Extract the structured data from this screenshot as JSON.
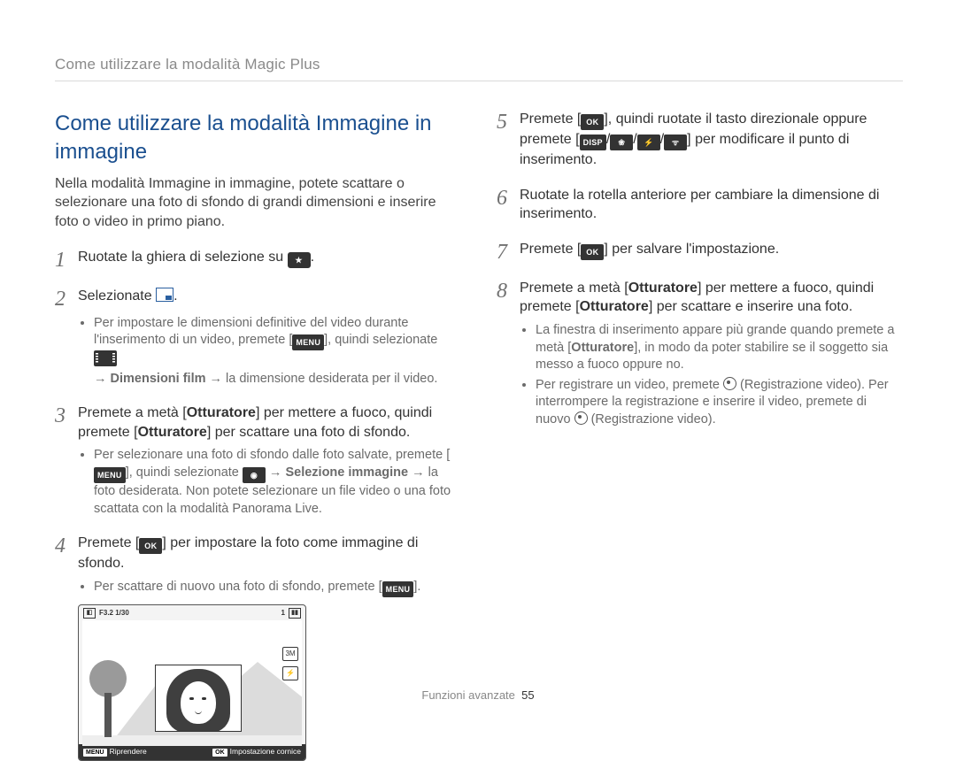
{
  "running_head": "Come utilizzare la modalità Magic Plus",
  "title": "Come utilizzare la modalità Immagine in immagine",
  "intro": "Nella modalità Immagine in immagine, potete scattare o selezionare una foto di sfondo di grandi dimensioni e inserire foto o video in primo piano.",
  "left_steps": {
    "s1": "Ruotate la ghiera di selezione su ",
    "s1_end": ".",
    "s2": "Selezionate ",
    "s2_end": ".",
    "s2_note_a": "Per impostare le dimensioni definitive del video durante l'inserimento di un video, premete [",
    "s2_note_a2": "], quindi selezionate ",
    "s2_note_a3": " → ",
    "s2_note_a_bold": "Dimensioni film",
    "s2_note_a4": " → la dimensione desiderata per il video.",
    "s3_a": "Premete a metà [",
    "s3_bold1": "Otturatore",
    "s3_b": "] per mettere a fuoco, quindi premete [",
    "s3_bold2": "Otturatore",
    "s3_c": "] per scattare una foto di sfondo.",
    "s3_note_a": "Per selezionare una foto di sfondo dalle foto salvate, premete [",
    "s3_note_b": "], quindi selezionate ",
    "s3_note_arrow": " → ",
    "s3_note_bold": "Selezione immagine",
    "s3_note_c": " → la foto desiderata. Non potete selezionare un file video o una foto scattata con la modalità Panorama Live.",
    "s4_a": "Premete [",
    "s4_b": "] per impostare la foto come immagine di sfondo.",
    "s4_note": "Per scattare di nuovo una foto di sfondo, premete [",
    "s4_note_end": "]."
  },
  "right_steps": {
    "s5_a": "Premete [",
    "s5_b": "], quindi ruotate il tasto direzionale oppure premete [",
    "s5_c": "] per modificare il punto di inserimento.",
    "s6": "Ruotate la rotella anteriore per cambiare la dimensione di inserimento.",
    "s7_a": "Premete [",
    "s7_b": "] per salvare l'impostazione.",
    "s8_a": "Premete a metà [",
    "s8_bold1": "Otturatore",
    "s8_b": "] per mettere a fuoco, quindi premete [",
    "s8_bold2": "Otturatore",
    "s8_c": "] per scattare e inserire una foto.",
    "s8_note1_a": "La finestra di inserimento appare più grande quando premete a metà [",
    "s8_note1_bold": "Otturatore",
    "s8_note1_b": "], in modo da poter stabilire se il soggetto sia messo a fuoco oppure no.",
    "s8_note2_a": "Per registrare un video, premete ",
    "s8_note2_b": " (Registrazione video). Per interrompere la registrazione e inserire il video, premete di nuovo ",
    "s8_note2_c": " (Registrazione video)."
  },
  "icons": {
    "menu": "MENU",
    "ok": "OK",
    "disp": "DISP",
    "camera": "◉"
  },
  "lcd": {
    "top_left_mode": "◧",
    "exposure": "F3.2 1/30",
    "shots": "1",
    "side1": "3M",
    "side2": "⚡",
    "bottom_left_btn": "MENU",
    "bottom_left": "Riprendere",
    "bottom_right_btn": "OK",
    "bottom_right": "Impostazione cornice"
  },
  "footer": {
    "section": "Funzioni avanzate",
    "page": "55"
  }
}
